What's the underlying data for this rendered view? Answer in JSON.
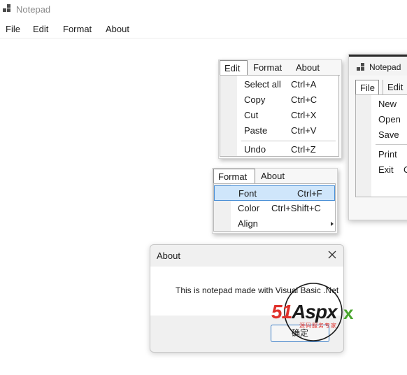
{
  "main_window": {
    "title": "Notepad",
    "menu": [
      "File",
      "Edit",
      "Format",
      "About"
    ]
  },
  "edit_panel": {
    "tabs": [
      "Edit",
      "Format",
      "About"
    ],
    "items": [
      {
        "label": "Select all",
        "shortcut": "Ctrl+A"
      },
      {
        "label": "Copy",
        "shortcut": "Ctrl+C"
      },
      {
        "label": "Cut",
        "shortcut": "Ctrl+X"
      },
      {
        "label": "Paste",
        "shortcut": "Ctrl+V"
      },
      {
        "label": "Undo",
        "shortcut": "Ctrl+Z"
      }
    ]
  },
  "format_panel": {
    "tabs": [
      "Format",
      "About"
    ],
    "items": [
      {
        "label": "Font",
        "shortcut": "Ctrl+F"
      },
      {
        "label": "Color",
        "shortcut": "Ctrl+Shift+C"
      },
      {
        "label": "Align",
        "shortcut": ""
      }
    ]
  },
  "second_window": {
    "title": "Notepad",
    "tabs": [
      "File",
      "Edit"
    ],
    "items": [
      {
        "label": "New",
        "shortcut": ""
      },
      {
        "label": "Open",
        "shortcut": ""
      },
      {
        "label": "Save",
        "shortcut": ""
      },
      {
        "label": "Print",
        "shortcut": ""
      },
      {
        "label": "Exit",
        "shortcut": "C"
      }
    ]
  },
  "about_dialog": {
    "title": "About",
    "message": "This is notepad made with Visual Basic .Net",
    "ok_label": "确定"
  },
  "watermark": {
    "brand_left": "51",
    "brand_right": "Aspx",
    "tagline": "源码服务专家"
  },
  "colors": {
    "highlight_fill": "#cfe6fb",
    "highlight_border": "#4a8fd6",
    "ok_border": "#3c7fc7",
    "watermark_red": "#e0312b",
    "watermark_green": "#4aa52e"
  }
}
